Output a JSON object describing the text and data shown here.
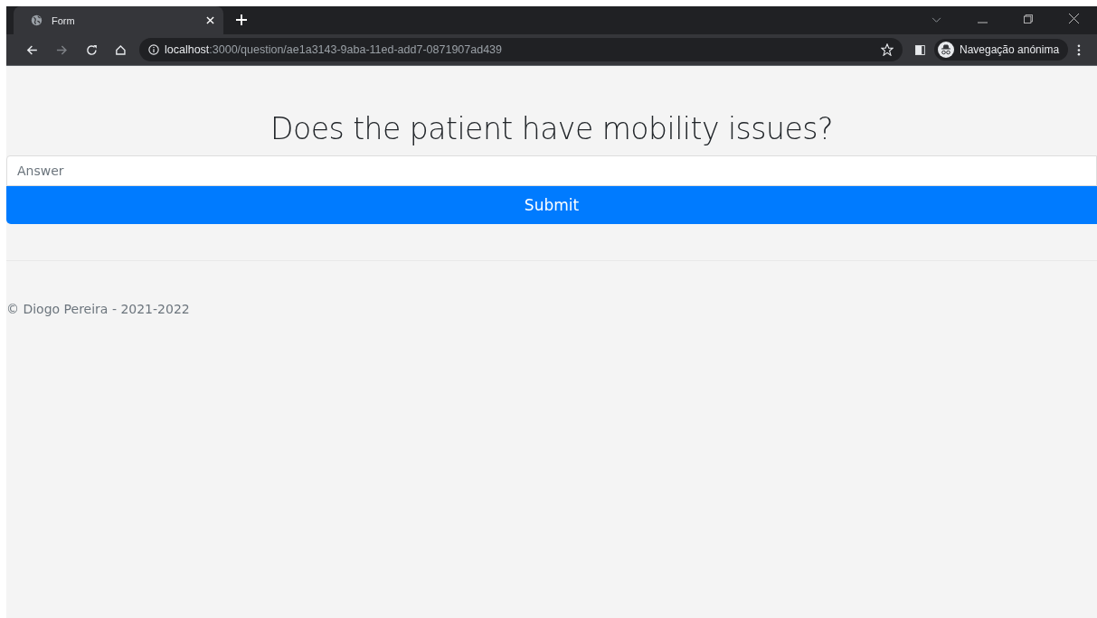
{
  "browser": {
    "tab": {
      "title": "Form"
    },
    "address": {
      "host": "localhost",
      "path": ":3000/question/ae1a3143-9aba-11ed-add7-0871907ad439"
    },
    "profile": {
      "label": "Navegação anónima"
    }
  },
  "page": {
    "question": "Does the patient have mobility issues?",
    "answer": {
      "placeholder": "Answer"
    },
    "submit": "Submit",
    "footer": "© Diogo Pereira - 2021-2022"
  }
}
